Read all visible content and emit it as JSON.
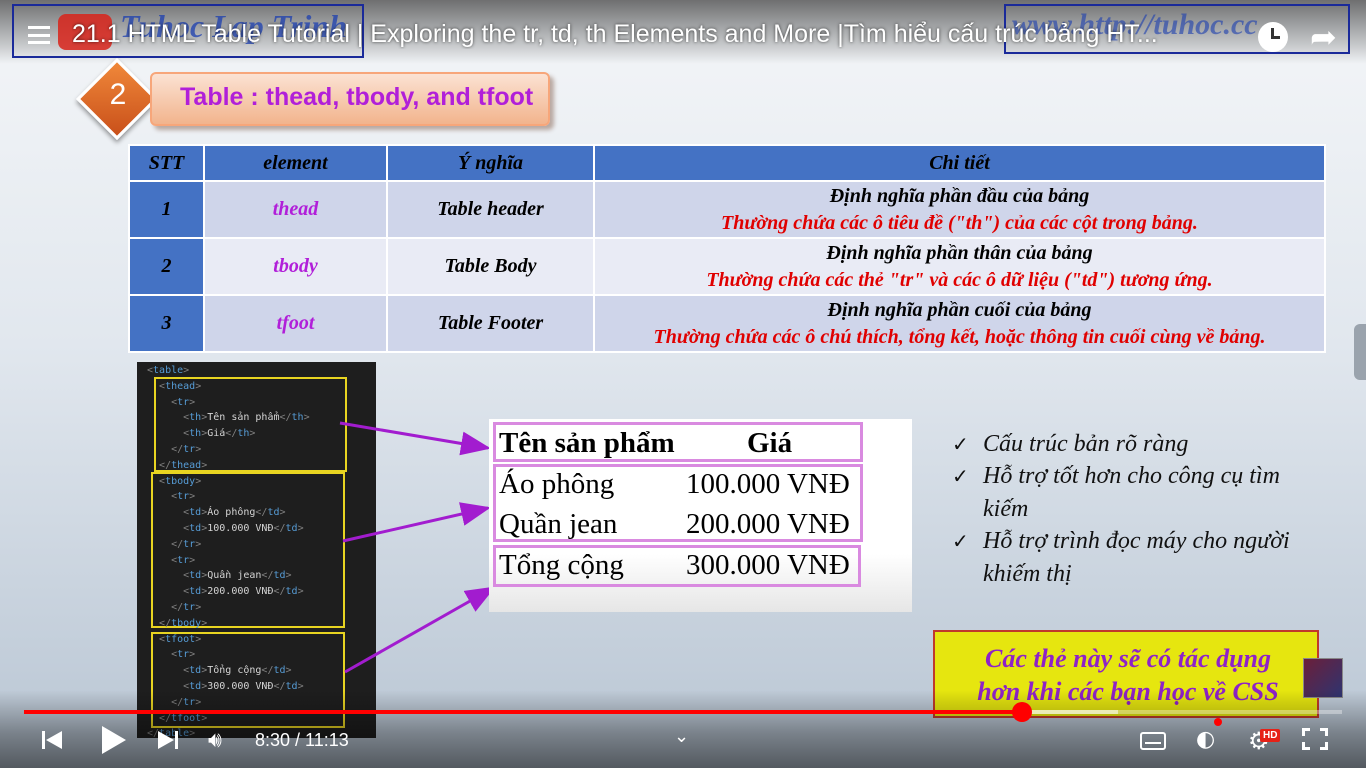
{
  "header": {
    "video_title": "21.1 HTML Table Tutorial | Exploring the tr, td, th Elements and More |Tìm hiểu cấu trúc bảng HT...",
    "watermark_left": "Tuhoc Lap Trinh",
    "watermark_right": "www.http://tuhoc.cc"
  },
  "section": {
    "number": "2",
    "title": "Table : thead, tbody, and tfoot"
  },
  "info_table": {
    "headers": [
      "STT",
      "element",
      "Ý nghĩa",
      "Chi tiết"
    ],
    "rows": [
      {
        "stt": "1",
        "element": "thead",
        "meaning": "Table header",
        "detail_1": "Định nghĩa phần đầu của bảng",
        "detail_2": "Thường chứa các ô tiêu đề (\"th\") của các cột trong bảng."
      },
      {
        "stt": "2",
        "element": "tbody",
        "meaning": "Table Body",
        "detail_1": "Định nghĩa phần thân của bảng",
        "detail_2": "Thường chứa các thẻ \"tr\" và các ô dữ liệu (\"td\") tương ứng."
      },
      {
        "stt": "3",
        "element": "tfoot",
        "meaning": "Table Footer",
        "detail_1": "Định nghĩa phần cuối của bảng",
        "detail_2": "Thường chứa các ô chú thích, tổng kết, hoặc thông tin cuối cùng về bảng."
      }
    ]
  },
  "code": {
    "lines": [
      "<table>",
      "  <thead>",
      "    <tr>",
      "      <th>Tên sản phẩm</th>",
      "      <th>Giá</th>",
      "    </tr>",
      "  </thead>",
      "  <tbody>",
      "    <tr>",
      "      <td>Áo phông</td>",
      "      <td>100.000 VNĐ</td>",
      "    </tr>",
      "    <tr>",
      "      <td>Quần jean</td>",
      "      <td>200.000 VNĐ</td>",
      "    </tr>",
      "  </tbody>",
      "  <tfoot>",
      "    <tr>",
      "      <td>Tổng cộng</td>",
      "      <td>300.000 VNĐ</td>",
      "    </tr>",
      "  </tfoot>",
      "</table>"
    ]
  },
  "preview": {
    "header": {
      "product": "Tên sản phẩm",
      "price": "Giá"
    },
    "body": [
      {
        "product": "Áo phông",
        "price": "100.000 VNĐ"
      },
      {
        "product": "Quần jean",
        "price": "200.000 VNĐ"
      }
    ],
    "footer": {
      "product": "Tổng cộng",
      "price": "300.000 VNĐ"
    }
  },
  "benefits": [
    "Cấu trúc bản rõ ràng",
    "Hỗ trợ tốt hơn cho công cụ tìm kiếm",
    "Hỗ trợ trình đọc máy cho người khiếm thị"
  ],
  "callout": {
    "line_1": "Các thẻ này sẽ có tác dụng",
    "line_2": "hơn khi các bạn học về CSS"
  },
  "player": {
    "time": "8:30 / 11:13",
    "progress": 0.757,
    "buffered": 0.83,
    "hd_label": "HD",
    "icons": {
      "menu": "menu-icon",
      "watch_later": "clock-icon",
      "share": "share-icon",
      "prev": "skip-previous-icon",
      "play": "play-icon",
      "next": "skip-next-icon",
      "volume": "volume-icon",
      "subtitles": "subtitles-icon",
      "autoplay": "autoplay-icon",
      "settings": "gear-icon",
      "fullscreen": "fullscreen-icon"
    },
    "colors": {
      "progress": "#ff0000",
      "accent_purple": "#b11fd9",
      "table_header": "#4472c4",
      "detail_red": "#e00000"
    }
  }
}
